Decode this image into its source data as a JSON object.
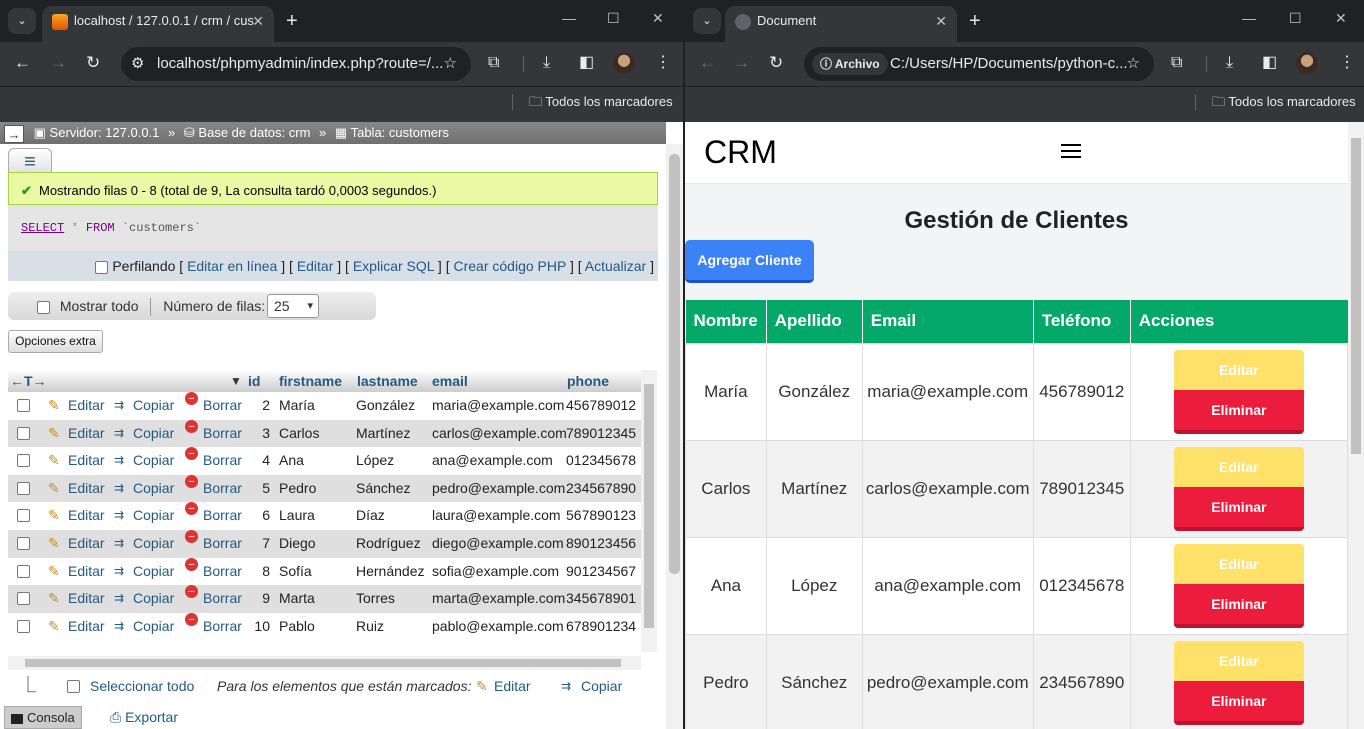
{
  "left_window": {
    "tab_title": "localhost / 127.0.0.1 / crm / cus",
    "url": "localhost/phpmyadmin/index.php?route=/...",
    "bookmarks": "Todos los marcadores",
    "breadcrumb": {
      "server": "Servidor: 127.0.0.1",
      "database": "Base de datos: crm",
      "table": "Tabla: customers",
      "sep": "»"
    },
    "success_message": "Mostrando filas 0 - 8 (total de 9, La consulta tardó 0,0003 segundos.)",
    "sql": {
      "select": "SELECT",
      "star": "*",
      "from": "FROM",
      "table": "`customers`"
    },
    "profiling": {
      "label": "Perfilando",
      "links": [
        "Editar en línea",
        "Editar",
        "Explicar SQL",
        "Crear código PHP",
        "Actualizar"
      ]
    },
    "nav": {
      "show_all": "Mostrar todo",
      "rows_label": "Número de filas:",
      "rows_value": "25"
    },
    "extra_options": "Opciones extra",
    "columns": [
      "id",
      "firstname",
      "lastname",
      "email",
      "phone"
    ],
    "row_actions": {
      "edit": "Editar",
      "copy": "Copiar",
      "delete": "Borrar"
    },
    "rows": [
      {
        "id": "2",
        "firstname": "María",
        "lastname": "González",
        "email": "maria@example.com",
        "phone": "456789012"
      },
      {
        "id": "3",
        "firstname": "Carlos",
        "lastname": "Martínez",
        "email": "carlos@example.com",
        "phone": "789012345"
      },
      {
        "id": "4",
        "firstname": "Ana",
        "lastname": "López",
        "email": "ana@example.com",
        "phone": "012345678"
      },
      {
        "id": "5",
        "firstname": "Pedro",
        "lastname": "Sánchez",
        "email": "pedro@example.com",
        "phone": "234567890"
      },
      {
        "id": "6",
        "firstname": "Laura",
        "lastname": "Díaz",
        "email": "laura@example.com",
        "phone": "567890123"
      },
      {
        "id": "7",
        "firstname": "Diego",
        "lastname": "Rodríguez",
        "email": "diego@example.com",
        "phone": "890123456"
      },
      {
        "id": "8",
        "firstname": "Sofía",
        "lastname": "Hernández",
        "email": "sofia@example.com",
        "phone": "901234567"
      },
      {
        "id": "9",
        "firstname": "Marta",
        "lastname": "Torres",
        "email": "marta@example.com",
        "phone": "345678901"
      },
      {
        "id": "10",
        "firstname": "Pablo",
        "lastname": "Ruiz",
        "email": "pablo@example.com",
        "phone": "678901234"
      }
    ],
    "bottom": {
      "select_all": "Seleccionar todo",
      "marked_label": "Para los elementos que están marcados:",
      "edit": "Editar",
      "copy": "Copiar"
    },
    "console": "Consola",
    "export": "Exportar"
  },
  "right_window": {
    "tab_title": "Document",
    "url_chip": "Archivo",
    "url": "C:/Users/HP/Documents/python-c...",
    "bookmarks": "Todos los marcadores",
    "brand": "CRM",
    "page_title": "Gestión de Clientes",
    "add_button": "Agregar Cliente",
    "columns": [
      "Nombre",
      "Apellido",
      "Email",
      "Teléfono",
      "Acciones"
    ],
    "edit_label": "Editar",
    "delete_label": "Eliminar",
    "rows": [
      {
        "nombre": "María",
        "apellido": "González",
        "email": "maria@example.com",
        "telefono": "456789012"
      },
      {
        "nombre": "Carlos",
        "apellido": "Martínez",
        "email": "carlos@example.com",
        "telefono": "789012345"
      },
      {
        "nombre": "Ana",
        "apellido": "López",
        "email": "ana@example.com",
        "telefono": "012345678"
      },
      {
        "nombre": "Pedro",
        "apellido": "Sánchez",
        "email": "pedro@example.com",
        "telefono": "234567890"
      }
    ]
  },
  "colors": {
    "chrome_dark": "#202124",
    "chrome_toolbar": "#35363a",
    "pma_link": "#235a81",
    "crm_header": "#04a96a",
    "crm_add": "#3b82f6",
    "crm_edit": "#fde168",
    "crm_delete": "#ec1c3c"
  }
}
